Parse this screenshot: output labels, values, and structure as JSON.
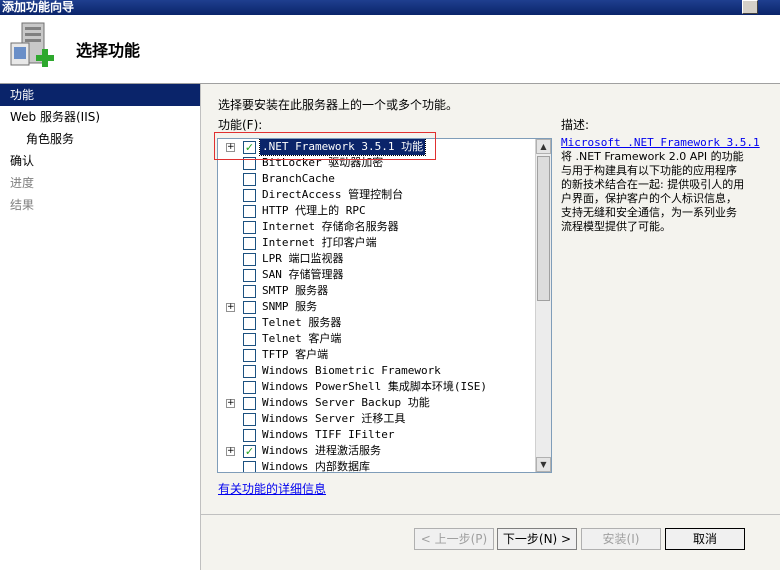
{
  "window": {
    "title": "添加功能向导"
  },
  "header": {
    "title": "选择功能"
  },
  "nav": {
    "items": [
      {
        "label": "功能"
      },
      {
        "label": "Web 服务器(IIS)"
      },
      {
        "label": "角色服务"
      },
      {
        "label": "确认"
      },
      {
        "label": "进度"
      },
      {
        "label": "结果"
      }
    ]
  },
  "main": {
    "prompt": "选择要安装在此服务器上的一个或多个功能。",
    "list_label": "功能(F):",
    "features": [
      {
        "label": ".NET Framework 3.5.1 功能",
        "checked": true
      },
      {
        "label": "BitLocker 驱动器加密",
        "checked": false
      },
      {
        "label": "BranchCache",
        "checked": false
      },
      {
        "label": "DirectAccess 管理控制台",
        "checked": false
      },
      {
        "label": "HTTP 代理上的 RPC",
        "checked": false
      },
      {
        "label": "Internet 存储命名服务器",
        "checked": false
      },
      {
        "label": "Internet 打印客户端",
        "checked": false
      },
      {
        "label": "LPR 端口监视器",
        "checked": false
      },
      {
        "label": "SAN 存储管理器",
        "checked": false
      },
      {
        "label": "SMTP 服务器",
        "checked": false
      },
      {
        "label": "SNMP 服务",
        "checked": false
      },
      {
        "label": "Telnet 服务器",
        "checked": false
      },
      {
        "label": "Telnet 客户端",
        "checked": false
      },
      {
        "label": "TFTP 客户端",
        "checked": false
      },
      {
        "label": "Windows Biometric Framework",
        "checked": false
      },
      {
        "label": "Windows PowerShell 集成脚本环境(ISE)",
        "checked": false
      },
      {
        "label": "Windows Server Backup 功能",
        "checked": false
      },
      {
        "label": "Windows Server 迁移工具",
        "checked": false
      },
      {
        "label": "Windows TIFF IFilter",
        "checked": false
      },
      {
        "label": "Windows 进程激活服务",
        "checked": true
      },
      {
        "label": "Windows 内部数据库",
        "checked": false
      }
    ],
    "description_title": "描述:",
    "description_link": "Microsoft .NET Framework 3.5.1",
    "description_text": "将 .NET Framework 2.0 API 的功能与用于构建具有以下功能的应用程序的新技术结合在一起: 提供吸引人的用户界面，保护客户的个人标识信息，支持无缝和安全通信，为一系列业务流程模型提供了可能。",
    "more_info_link": "有关功能的详细信息"
  },
  "buttons": {
    "back": "< 上一步(P)",
    "next": "下一步(N) >",
    "install": "安装(I)",
    "cancel": "取消"
  }
}
